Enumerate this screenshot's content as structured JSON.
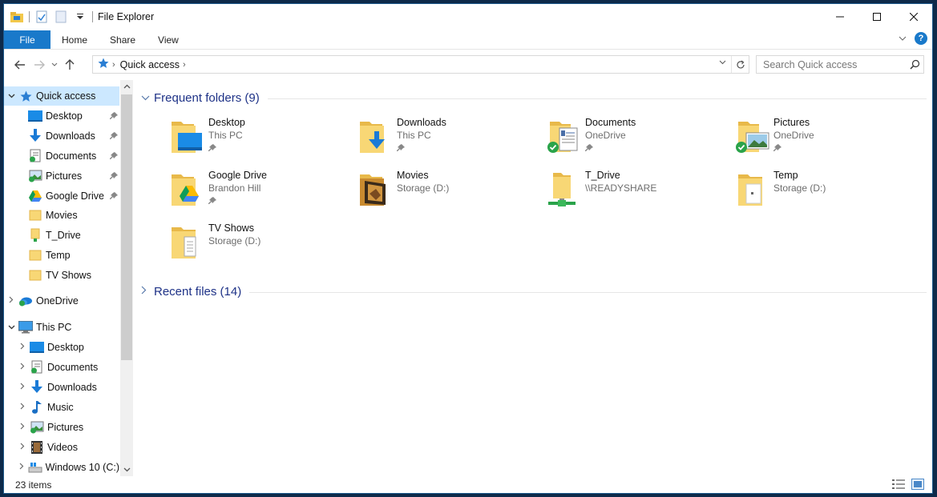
{
  "window": {
    "title": "File Explorer"
  },
  "ribbon": {
    "tabs": [
      "File",
      "Home",
      "Share",
      "View"
    ],
    "help_label": "?"
  },
  "address": {
    "path": "Quick access"
  },
  "search": {
    "placeholder": "Search Quick access"
  },
  "navpane": {
    "items": [
      {
        "label": "Quick access",
        "icon": "star-icon",
        "level": 0,
        "expanded": true,
        "selected": true
      },
      {
        "label": "Desktop",
        "icon": "desktop-icon",
        "level": 1,
        "pinned": true
      },
      {
        "label": "Downloads",
        "icon": "downloads-icon",
        "level": 1,
        "pinned": true
      },
      {
        "label": "Documents",
        "icon": "documents-icon",
        "level": 1,
        "pinned": true
      },
      {
        "label": "Pictures",
        "icon": "pictures-icon",
        "level": 1,
        "pinned": true
      },
      {
        "label": "Google Drive",
        "icon": "google-drive-icon",
        "level": 1,
        "pinned": true
      },
      {
        "label": "Movies",
        "icon": "folder-icon",
        "level": 1
      },
      {
        "label": "T_Drive",
        "icon": "network-folder-icon",
        "level": 1
      },
      {
        "label": "Temp",
        "icon": "folder-icon",
        "level": 1
      },
      {
        "label": "TV Shows",
        "icon": "folder-icon",
        "level": 1
      },
      {
        "label": "OneDrive",
        "icon": "onedrive-icon",
        "level": 0,
        "expanded": false
      },
      {
        "label": "This PC",
        "icon": "this-pc-icon",
        "level": 0,
        "expanded": true
      },
      {
        "label": "Desktop",
        "icon": "desktop-icon",
        "level": 1,
        "expandable": true
      },
      {
        "label": "Documents",
        "icon": "documents-icon",
        "level": 1,
        "expandable": true
      },
      {
        "label": "Downloads",
        "icon": "downloads-icon",
        "level": 1,
        "expandable": true
      },
      {
        "label": "Music",
        "icon": "music-icon",
        "level": 1,
        "expandable": true
      },
      {
        "label": "Pictures",
        "icon": "pictures-icon",
        "level": 1,
        "expandable": true
      },
      {
        "label": "Videos",
        "icon": "videos-icon",
        "level": 1,
        "expandable": true
      },
      {
        "label": "Windows 10 (C:)",
        "icon": "drive-icon",
        "level": 1,
        "expandable": true
      }
    ]
  },
  "content": {
    "frequent_header": "Frequent folders (9)",
    "recent_header": "Recent files (14)",
    "folders": [
      {
        "name": "Desktop",
        "location": "This PC",
        "pinned": true,
        "overlay": "desktop"
      },
      {
        "name": "Downloads",
        "location": "This PC",
        "pinned": true,
        "overlay": "downloads"
      },
      {
        "name": "Documents",
        "location": "OneDrive",
        "pinned": true,
        "overlay": "documents",
        "synced": true
      },
      {
        "name": "Pictures",
        "location": "OneDrive",
        "pinned": true,
        "overlay": "pictures",
        "synced": true
      },
      {
        "name": "Google Drive",
        "location": "Brandon Hill",
        "pinned": true,
        "overlay": "gdrive"
      },
      {
        "name": "Movies",
        "location": "Storage (D:)",
        "pinned": false,
        "overlay": "movies"
      },
      {
        "name": "T_Drive",
        "location": "\\\\READYSHARE",
        "pinned": false,
        "overlay": "network"
      },
      {
        "name": "Temp",
        "location": "Storage (D:)",
        "pinned": false,
        "overlay": "temp"
      },
      {
        "name": "TV Shows",
        "location": "Storage (D:)",
        "pinned": false,
        "overlay": "tvshows"
      }
    ]
  },
  "status": {
    "item_count": "23 items"
  },
  "colors": {
    "accent": "#1979ca",
    "selected": "#cce8ff",
    "header_text": "#1e3287",
    "folder": "#f8d775"
  }
}
